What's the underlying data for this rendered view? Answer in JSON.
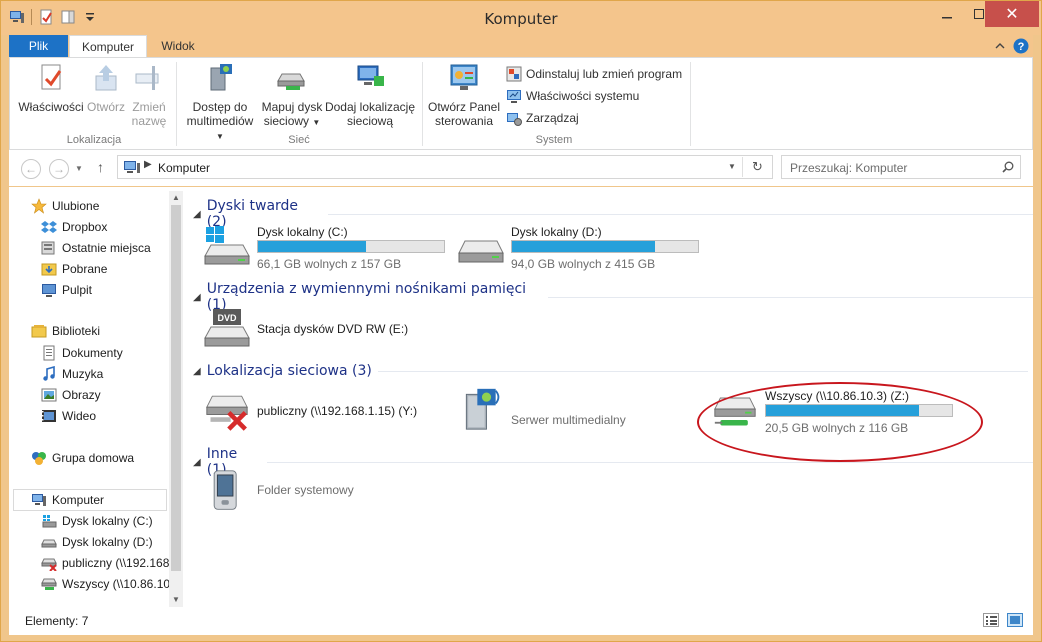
{
  "window": {
    "title": "Komputer"
  },
  "ribbon": {
    "tabs": {
      "file": "Plik",
      "computer": "Komputer",
      "view": "Widok"
    },
    "location": {
      "label": "Lokalizacja",
      "properties": "Właściwości",
      "open": "Otwórz",
      "rename_1": "Zmień",
      "rename_2": "nazwę"
    },
    "network": {
      "label": "Sieć",
      "media_1": "Dostęp do",
      "media_2": "multimediów",
      "map_1": "Mapuj dysk",
      "map_2": "sieciowy",
      "add_1": "Dodaj lokalizację",
      "add_2": "sieciową"
    },
    "system": {
      "label": "System",
      "cp_1": "Otwórz Panel",
      "cp_2": "sterowania",
      "uninstall": "Odinstaluj lub zmień program",
      "sysprops": "Właściwości systemu",
      "manage": "Zarządzaj"
    }
  },
  "address": {
    "path": "Komputer",
    "search_placeholder": "Przeszukaj: Komputer"
  },
  "nav": {
    "favorites": "Ulubione",
    "dropbox": "Dropbox",
    "recent": "Ostatnie miejsca",
    "downloads": "Pobrane",
    "desktop": "Pulpit",
    "libraries": "Biblioteki",
    "documents": "Dokumenty",
    "music": "Muzyka",
    "pictures": "Obrazy",
    "videos": "Wideo",
    "homegroup": "Grupa domowa",
    "computer": "Komputer",
    "drive_c": "Dysk lokalny (C:)",
    "drive_d": "Dysk lokalny (D:)",
    "drive_y": "publiczny (\\\\192.168",
    "drive_z": "Wszyscy (\\\\10.86.10."
  },
  "sections": {
    "hdd": "Dyski twarde (2)",
    "removable": "Urządzenia z wymiennymi nośnikami pamięci (1)",
    "network": "Lokalizacja sieciowa (3)",
    "other": "Inne (1)"
  },
  "drives": {
    "c": {
      "name": "Dysk lokalny (C:)",
      "free": "66,1 GB wolnych z 157 GB",
      "used_fraction": 0.58
    },
    "d": {
      "name": "Dysk lokalny (D:)",
      "free": "94,0 GB wolnych z 415 GB",
      "used_fraction": 0.77
    },
    "dvd": {
      "name": "Stacja dysków DVD RW (E:)",
      "badge": "DVD"
    },
    "y": {
      "name": "publiczny (\\\\192.168.1.15) (Y:)"
    },
    "media": {
      "name": "Serwer multimedialny"
    },
    "z": {
      "name": "Wszyscy (\\\\10.86.10.3) (Z:)",
      "free": "20,5 GB wolnych z 116 GB",
      "used_fraction": 0.82
    },
    "sysfolder": {
      "name": "Folder systemowy"
    }
  },
  "status": {
    "count": "Elementy: 7"
  },
  "colors": {
    "accent": "#1d72c6",
    "bar": "#26a0da",
    "header": "#1e3287",
    "title_bg": "#f4c58c",
    "highlight": "#c8161d"
  }
}
